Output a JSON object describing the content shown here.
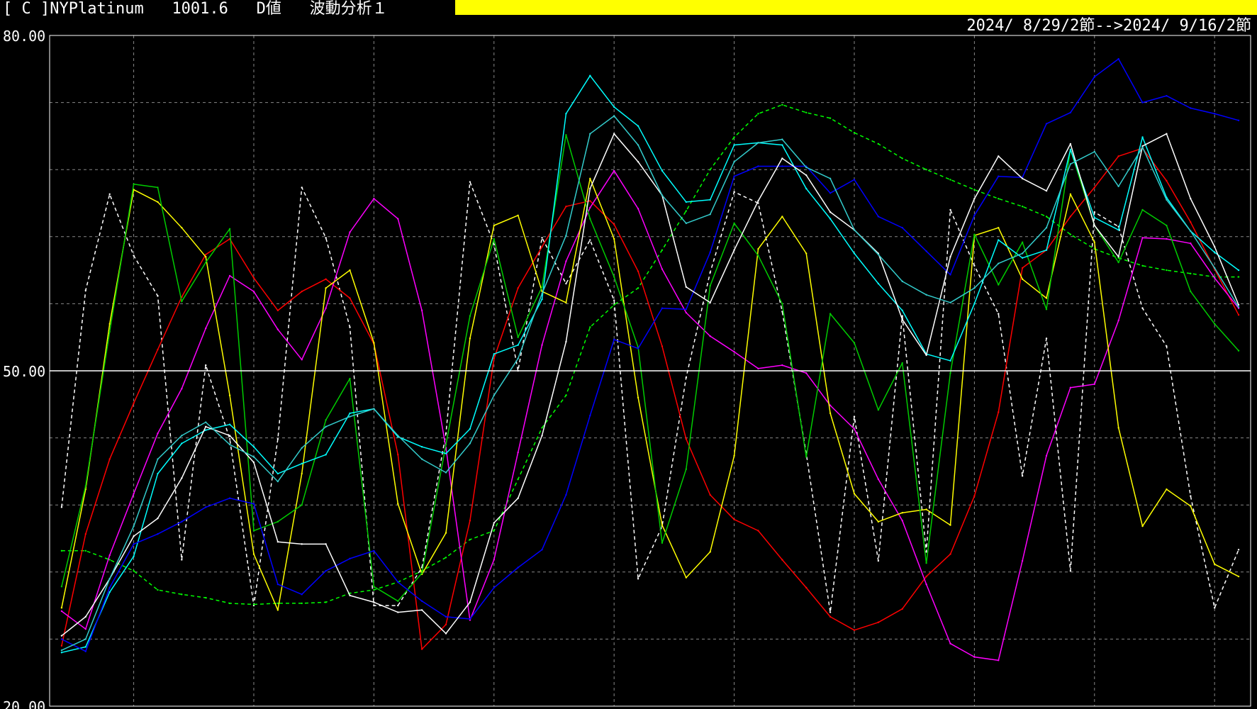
{
  "header": {
    "bracket": "[ C ]",
    "instrument": "NYPlatinum",
    "price": "1001.6",
    "indicator": "D値",
    "mode": "波動分析１",
    "date_range": "2024/ 8/29/2節-->2024/ 9/16/2節",
    "bar_color": "#ffff00"
  },
  "chart_data": {
    "type": "line",
    "ylim": [
      20,
      80
    ],
    "y_ticks": [
      "80.00",
      "50.00",
      "20.00"
    ],
    "reference_line": 50,
    "grid": true,
    "x_count": 50,
    "series": [
      {
        "color": "#ffffff",
        "dash": true,
        "values": [
          37.8,
          57.2,
          65.8,
          60.3,
          56.7,
          33.1,
          50.5,
          43.9,
          29.0,
          43.9,
          66.4,
          61.9,
          53.9,
          29.0,
          29.0,
          32.4,
          44.4,
          66.9,
          61.3,
          50.0,
          61.9,
          57.8,
          61.7,
          56.3,
          31.4,
          36.1,
          49.4,
          58.8,
          66.0,
          65.0,
          55.3,
          42.6,
          28.4,
          45.9,
          33.0,
          54.9,
          33.8,
          64.4,
          59.4,
          55.1,
          40.6,
          52.9,
          32.1,
          64.2,
          62.9,
          55.6,
          52.2,
          38.8,
          28.8,
          34.0
        ]
      },
      {
        "color": "#00ff00",
        "dash": true,
        "values": [
          33.9,
          33.9,
          33.1,
          32.1,
          30.4,
          30.0,
          29.7,
          29.2,
          29.1,
          29.2,
          29.2,
          29.3,
          30.1,
          30.4,
          31.1,
          32.1,
          33.3,
          34.9,
          35.7,
          40.3,
          44.9,
          47.8,
          53.9,
          55.9,
          57.4,
          60.8,
          64.3,
          68.0,
          70.9,
          73.0,
          73.8,
          73.1,
          72.6,
          71.3,
          70.3,
          69.0,
          68.0,
          67.1,
          66.2,
          65.4,
          64.7,
          63.8,
          62.2,
          60.9,
          60.1,
          59.4,
          59.0,
          58.7,
          58.4,
          58.4
        ]
      },
      {
        "color": "#ff0000",
        "dash": false,
        "values": [
          25.4,
          35.4,
          42.1,
          47.1,
          51.9,
          56.6,
          60.4,
          61.8,
          58.3,
          55.4,
          57.1,
          58.2,
          56.5,
          52.4,
          42.5,
          25.1,
          27.3,
          36.6,
          51.1,
          57.4,
          61.1,
          64.7,
          65.2,
          63.1,
          58.9,
          52.2,
          43.9,
          38.9,
          36.7,
          35.7,
          33.1,
          30.6,
          28.0,
          26.8,
          27.5,
          28.7,
          31.6,
          33.6,
          38.8,
          46.3,
          59.2,
          60.8,
          63.8,
          66.4,
          69.2,
          69.9,
          67.0,
          63.3,
          59.1,
          55.0
        ]
      },
      {
        "color": "#ff00ff",
        "dash": false,
        "values": [
          28.5,
          26.9,
          33.5,
          39.0,
          44.4,
          48.4,
          53.8,
          58.5,
          57.1,
          53.7,
          51.0,
          55.6,
          62.4,
          65.4,
          63.6,
          55.4,
          43.1,
          27.7,
          33.1,
          42.7,
          52.3,
          59.8,
          64.6,
          67.9,
          64.5,
          59.1,
          55.2,
          53.1,
          51.7,
          50.2,
          50.5,
          49.8,
          46.9,
          44.8,
          40.3,
          36.6,
          30.9,
          25.6,
          24.4,
          24.1,
          33.0,
          42.4,
          48.5,
          48.8,
          54.5,
          61.9,
          61.8,
          61.4,
          58.3,
          55.6
        ]
      },
      {
        "color": "#ffff00",
        "dash": false,
        "values": [
          28.8,
          39.4,
          54.2,
          66.2,
          65.1,
          62.8,
          60.2,
          47.8,
          33.6,
          28.6,
          40.8,
          57.4,
          59.0,
          52.5,
          38.1,
          31.8,
          35.5,
          52.9,
          63.0,
          63.9,
          57.1,
          56.1,
          67.2,
          61.8,
          47.6,
          36.2,
          31.5,
          33.8,
          42.4,
          60.9,
          63.8,
          60.5,
          46.2,
          39.0,
          36.5,
          37.3,
          37.6,
          36.2,
          62.1,
          62.8,
          58.2,
          56.5,
          65.8,
          61.5,
          44.9,
          36.1,
          39.4,
          37.9,
          32.7,
          31.6
        ]
      },
      {
        "color": "#00cc00",
        "dash": false,
        "values": [
          30.7,
          39.7,
          53.5,
          66.7,
          66.4,
          56.2,
          59.7,
          62.7,
          35.7,
          36.5,
          38.0,
          45.6,
          49.3,
          30.7,
          29.4,
          31.9,
          43.4,
          54.9,
          61.8,
          53.0,
          57.5,
          71.1,
          63.6,
          58.4,
          52.1,
          34.6,
          41.2,
          57.6,
          63.2,
          60.3,
          56.0,
          42.3,
          55.1,
          52.5,
          46.5,
          50.7,
          32.8,
          49.8,
          62.2,
          57.7,
          61.5,
          55.5,
          69.8,
          63.0,
          59.7,
          64.4,
          63.0,
          57.1,
          54.2,
          51.8
        ]
      },
      {
        "color": "#00ffff",
        "dash": false,
        "values": [
          24.8,
          25.3,
          30.2,
          33.4,
          40.8,
          43.5,
          44.7,
          45.2,
          43.2,
          40.8,
          41.7,
          42.5,
          46.2,
          46.6,
          44.1,
          43.2,
          42.6,
          44.8,
          51.5,
          52.3,
          56.4,
          73.0,
          76.4,
          73.6,
          71.9,
          67.9,
          65.1,
          65.3,
          70.2,
          70.4,
          70.2,
          66.3,
          63.6,
          60.5,
          57.8,
          55.4,
          51.5,
          50.9,
          56.0,
          61.7,
          60.1,
          60.8,
          69.8,
          63.7,
          62.6,
          70.9,
          65.5,
          62.5,
          60.6,
          59.0
        ]
      },
      {
        "color": "#0000ff",
        "dash": false,
        "values": [
          26.0,
          24.9,
          30.6,
          34.5,
          35.4,
          36.5,
          37.8,
          38.6,
          38.1,
          30.9,
          30.0,
          32.1,
          33.2,
          33.9,
          31.1,
          29.4,
          28.0,
          27.8,
          30.6,
          32.4,
          34.0,
          38.9,
          46.0,
          52.8,
          52.0,
          55.6,
          55.5,
          60.6,
          67.4,
          68.3,
          68.3,
          68.3,
          65.9,
          67.1,
          63.8,
          62.8,
          60.7,
          58.6,
          63.9,
          67.4,
          67.3,
          72.1,
          73.1,
          76.3,
          77.9,
          74.0,
          74.6,
          73.5,
          73.0,
          72.4
        ]
      },
      {
        "color": "#ffffff",
        "dash": false,
        "values": [
          26.3,
          28.0,
          31.4,
          35.2,
          36.8,
          40.4,
          45.0,
          44.2,
          41.8,
          34.7,
          34.5,
          34.5,
          29.9,
          29.3,
          28.4,
          28.6,
          26.5,
          29.3,
          36.4,
          38.6,
          44.2,
          52.6,
          66.3,
          71.2,
          68.7,
          65.7,
          57.5,
          56.1,
          60.8,
          65.2,
          69.0,
          67.5,
          64.2,
          62.6,
          60.5,
          54.6,
          51.4,
          60.2,
          65.4,
          69.2,
          67.2,
          66.1,
          70.3,
          63.0,
          60.2,
          70.1,
          71.2,
          65.4,
          61.1,
          55.9
        ]
      },
      {
        "color": "#33cccc",
        "dash": false,
        "values": [
          25.0,
          26.0,
          31.4,
          36.1,
          42.1,
          44.2,
          45.4,
          43.4,
          42.3,
          40.1,
          43.1,
          45.0,
          45.9,
          46.6,
          44.2,
          42.1,
          40.9,
          43.5,
          47.8,
          51.1,
          56.9,
          62.1,
          71.2,
          72.8,
          70.2,
          65.7,
          63.2,
          64.0,
          68.7,
          70.4,
          70.7,
          68.2,
          67.2,
          62.6,
          60.4,
          58.0,
          56.8,
          56.1,
          57.4,
          59.6,
          60.5,
          62.8,
          68.5,
          69.6,
          66.5,
          70.0,
          65.3,
          62.5,
          59.2,
          55.7
        ]
      }
    ]
  }
}
